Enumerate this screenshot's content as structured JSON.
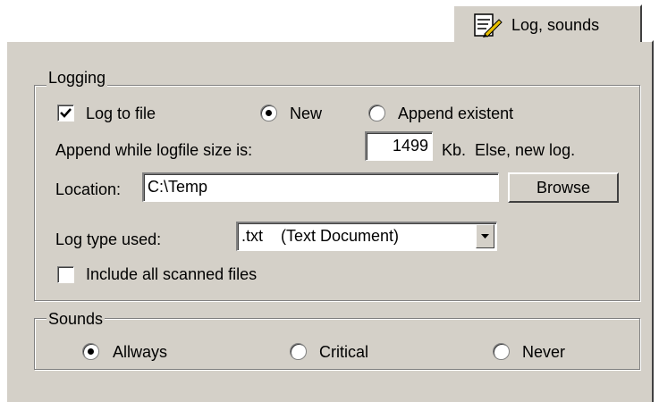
{
  "tab": {
    "label": "Log, sounds",
    "icon": "notepad-pencil-icon"
  },
  "logging": {
    "legend": "Logging",
    "log_to_file": {
      "label": "Log to file",
      "checked": true
    },
    "mode_new": {
      "label": "New",
      "selected": true
    },
    "mode_append": {
      "label": "Append existent",
      "selected": false
    },
    "append_size_label": "Append while logfile size is:",
    "append_size_value": "1499",
    "append_size_suffix": "Kb.  Else, new log.",
    "location_label": "Location:",
    "location_value": "C:\\Temp",
    "browse_label": "Browse",
    "log_type_label": "Log type used:",
    "log_type_value": ".txt    (Text Document)",
    "include_all": {
      "label": "Include all scanned files",
      "checked": false
    }
  },
  "sounds": {
    "legend": "Sounds",
    "options": [
      {
        "label": "Allways",
        "selected": true
      },
      {
        "label": "Critical",
        "selected": false
      },
      {
        "label": "Never",
        "selected": false
      }
    ]
  },
  "colors": {
    "face": "#d4d0c8",
    "highlight": "#ffffff",
    "shadow": "#808080",
    "dark_shadow": "#404040"
  }
}
